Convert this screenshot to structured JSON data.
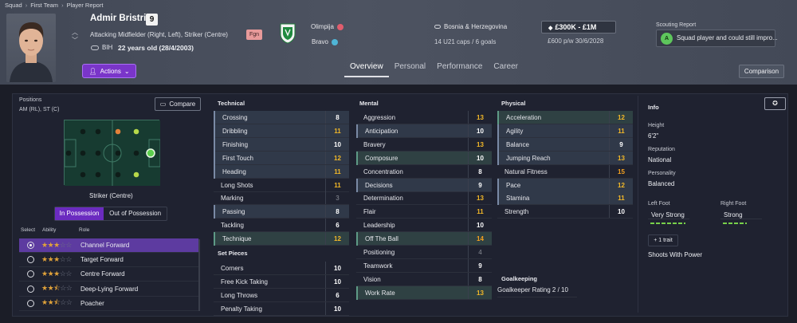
{
  "breadcrumb": [
    "Squad",
    "First Team",
    "Player Report"
  ],
  "player": {
    "name": "Admir Bristric",
    "number": "9",
    "positions": "Attacking Midfielder (Right, Left), Striker (Centre)",
    "nationality_code": "BIH",
    "age": "22 years old (28/4/2003)",
    "fgn_badge": "Fgn",
    "club": "Olimpija",
    "division": "Bravo",
    "nation": "Bosnia & Herzegovina",
    "caps": "14 U21 caps / 6 goals",
    "value": "£300K - £1M",
    "wage": "£600 p/w 30/6/2028"
  },
  "scouting": {
    "title": "Scouting Report",
    "grade": "A",
    "text": "Squad player and could still impro..."
  },
  "actions_label": "Actions",
  "tabs": [
    {
      "label": "Overview",
      "active": true
    },
    {
      "label": "Personal",
      "active": false
    },
    {
      "label": "Performance",
      "active": false
    },
    {
      "label": "Career",
      "active": false
    }
  ],
  "comparison_label": "Comparison",
  "positions_panel": {
    "label": "Positions",
    "value": "AM (RL), ST (C)",
    "compare_label": "Compare",
    "role_label": "Striker (Centre)",
    "in_possession": "In Possession",
    "out_possession": "Out of Possession",
    "headers": {
      "select": "Select",
      "ability": "Ability",
      "role": "Role"
    },
    "roles": [
      {
        "name": "Channel Forward",
        "stars": 3,
        "selected": true
      },
      {
        "name": "Target Forward",
        "stars": 3,
        "selected": false
      },
      {
        "name": "Centre Forward",
        "stars": 3,
        "selected": false
      },
      {
        "name": "Deep-Lying Forward",
        "stars": 2.5,
        "selected": false
      },
      {
        "name": "Poacher",
        "stars": 2.5,
        "selected": false
      }
    ]
  },
  "technical": {
    "title": "Technical",
    "attrs": [
      {
        "name": "Crossing",
        "value": 8,
        "hl": "b"
      },
      {
        "name": "Dribbling",
        "value": 11,
        "hl": "b"
      },
      {
        "name": "Finishing",
        "value": 10,
        "hl": "b"
      },
      {
        "name": "First Touch",
        "value": 12,
        "hl": "b"
      },
      {
        "name": "Heading",
        "value": 11,
        "hl": "b"
      },
      {
        "name": "Long Shots",
        "value": 11,
        "hl": ""
      },
      {
        "name": "Marking",
        "value": 3,
        "hl": ""
      },
      {
        "name": "Passing",
        "value": 8,
        "hl": "b"
      },
      {
        "name": "Tackling",
        "value": 6,
        "hl": ""
      },
      {
        "name": "Technique",
        "value": 12,
        "hl": "g"
      }
    ]
  },
  "set_pieces": {
    "title": "Set Pieces",
    "attrs": [
      {
        "name": "Corners",
        "value": 10,
        "hl": ""
      },
      {
        "name": "Free Kick Taking",
        "value": 10,
        "hl": ""
      },
      {
        "name": "Long Throws",
        "value": 6,
        "hl": ""
      },
      {
        "name": "Penalty Taking",
        "value": 10,
        "hl": ""
      }
    ]
  },
  "mental": {
    "title": "Mental",
    "attrs": [
      {
        "name": "Aggression",
        "value": 13,
        "hl": ""
      },
      {
        "name": "Anticipation",
        "value": 10,
        "hl": "b"
      },
      {
        "name": "Bravery",
        "value": 13,
        "hl": ""
      },
      {
        "name": "Composure",
        "value": 10,
        "hl": "g"
      },
      {
        "name": "Concentration",
        "value": 8,
        "hl": ""
      },
      {
        "name": "Decisions",
        "value": 9,
        "hl": "b"
      },
      {
        "name": "Determination",
        "value": 13,
        "hl": ""
      },
      {
        "name": "Flair",
        "value": 11,
        "hl": ""
      },
      {
        "name": "Leadership",
        "value": 10,
        "hl": ""
      },
      {
        "name": "Off The Ball",
        "value": 14,
        "hl": "g"
      },
      {
        "name": "Positioning",
        "value": 4,
        "hl": ""
      },
      {
        "name": "Teamwork",
        "value": 9,
        "hl": ""
      },
      {
        "name": "Vision",
        "value": 8,
        "hl": ""
      },
      {
        "name": "Work Rate",
        "value": 13,
        "hl": "g"
      }
    ]
  },
  "physical": {
    "title": "Physical",
    "attrs": [
      {
        "name": "Acceleration",
        "value": 12,
        "hl": "g"
      },
      {
        "name": "Agility",
        "value": 11,
        "hl": "b"
      },
      {
        "name": "Balance",
        "value": 9,
        "hl": "b"
      },
      {
        "name": "Jumping Reach",
        "value": 13,
        "hl": "b"
      },
      {
        "name": "Natural Fitness",
        "value": 15,
        "hl": ""
      },
      {
        "name": "Pace",
        "value": 12,
        "hl": "b"
      },
      {
        "name": "Stamina",
        "value": 11,
        "hl": "b"
      },
      {
        "name": "Strength",
        "value": 10,
        "hl": ""
      }
    ]
  },
  "goalkeeping": {
    "title": "Goalkeeping",
    "rating": "Goalkeeper Rating 2 / 10"
  },
  "info": {
    "title": "Info",
    "height_label": "Height",
    "height": "6'2\"",
    "reputation_label": "Reputation",
    "reputation": "National",
    "personality_label": "Personality",
    "personality": "Balanced",
    "left_foot_label": "Left Foot",
    "left_foot": "Very Strong",
    "right_foot_label": "Right Foot",
    "right_foot": "Strong",
    "trait_count": "1 trait",
    "trait": "Shoots With Power"
  },
  "colors": {
    "accent": "#7a35c9",
    "highlight_gold": "#f4b928",
    "grade_green": "#5ec65c"
  }
}
